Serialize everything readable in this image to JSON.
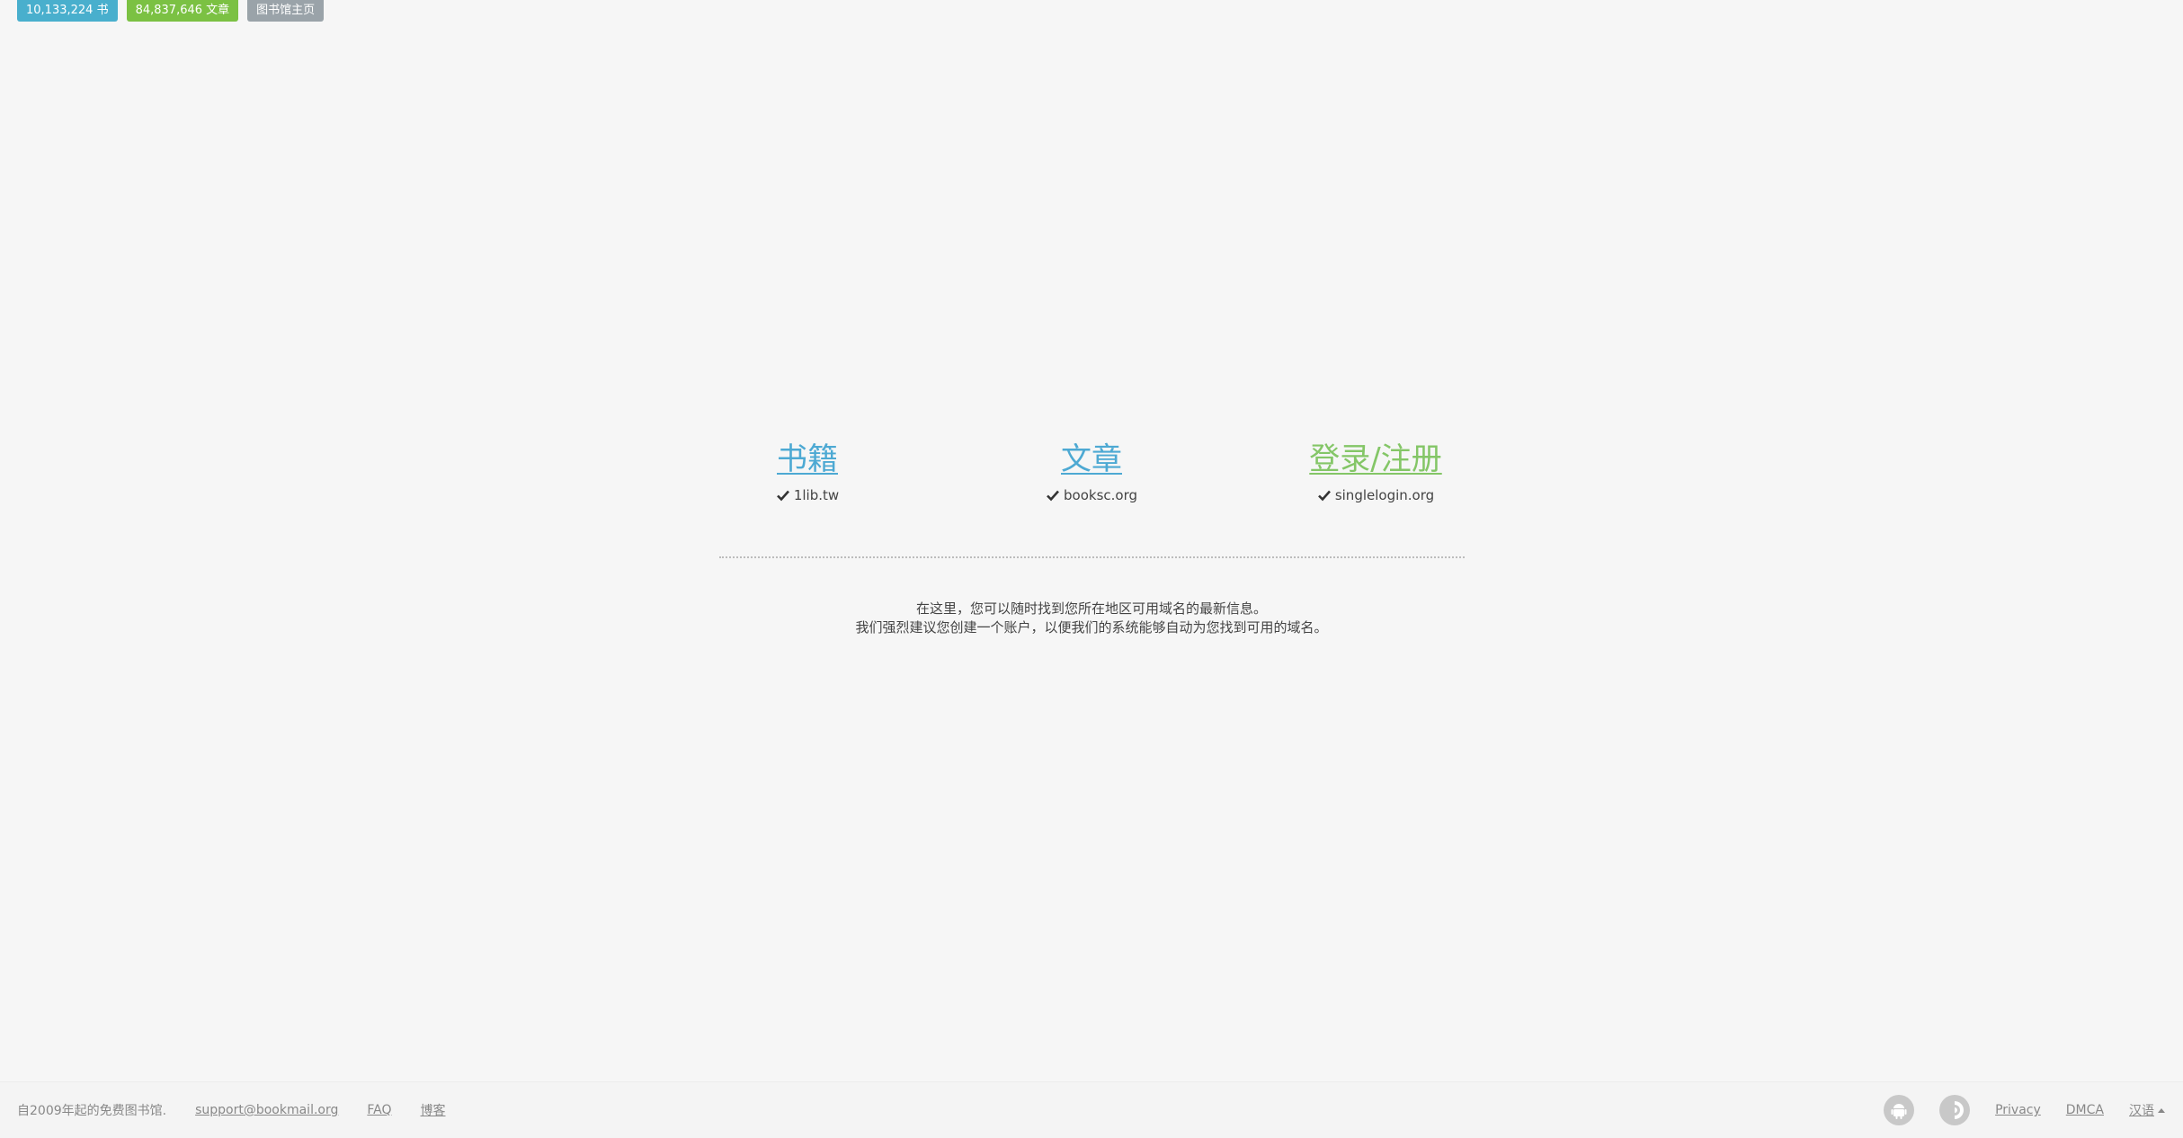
{
  "topbar": {
    "books_badge": "10,133,224 书",
    "articles_badge": "84,837,646 文章",
    "home_badge": "图书馆主页"
  },
  "links": {
    "books": {
      "title": "书籍",
      "domain": "1lib.tw"
    },
    "articles": {
      "title": "文章",
      "domain": "booksc.org"
    },
    "login": {
      "title": "登录/注册",
      "domain": "singlelogin.org"
    }
  },
  "info": {
    "line1": "在这里，您可以随时找到您所在地区可用域名的最新信息。",
    "line2": "我们强烈建议您创建一个账户，以便我们的系统能够自动为您找到可用的域名。"
  },
  "footer": {
    "since_text": "自2009年起的免费图书馆.",
    "support_email": "support@bookmail.org",
    "faq_label": "FAQ",
    "blog_label": "博客",
    "privacy_label": "Privacy",
    "dmca_label": "DMCA",
    "language_label": "汉语"
  },
  "colors": {
    "books_badge": "#49afcd",
    "articles_badge": "#7bc143",
    "home_badge": "#9aa3a9",
    "link_blue": "#4da9d3",
    "link_green": "#84c667"
  },
  "icons": {
    "check": "check-icon",
    "android": "android-icon",
    "tor": "tor-icon",
    "language_caret": "caret-up-icon"
  }
}
